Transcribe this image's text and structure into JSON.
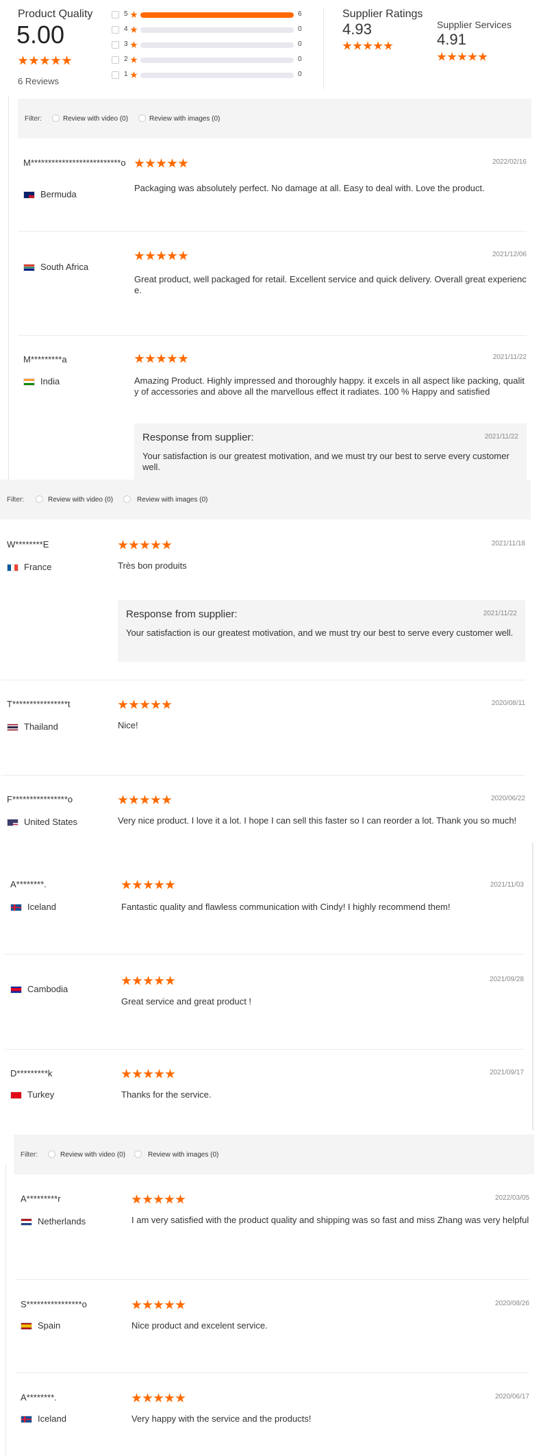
{
  "summary": {
    "product_quality_title": "Product Quality",
    "product_quality_score": "5.00",
    "reviews_count": "6 Reviews",
    "rating_rows": [
      {
        "num": "5",
        "count": "6",
        "fill": 1.0
      },
      {
        "num": "4",
        "count": "0",
        "fill": 0
      },
      {
        "num": "3",
        "count": "0",
        "fill": 0
      },
      {
        "num": "2",
        "count": "0",
        "fill": 0
      },
      {
        "num": "1",
        "count": "0",
        "fill": 0
      }
    ],
    "supplier_ratings_title": "Supplier Ratings",
    "supplier_ratings_score": "4.93",
    "supplier_services_title": "Supplier Services",
    "supplier_services_score": "4.91"
  },
  "filter": {
    "label": "Filter:",
    "video": "Review with video (0)",
    "images": "Review with images (0)"
  },
  "response_title": "Response from supplier:",
  "colors": {
    "accent": "#ff6a00",
    "panel": "#f4f4f4"
  },
  "reviews": [
    {
      "name": "M**************************o",
      "country": "Bermuda",
      "flag": "bermuda",
      "date": "2022/02/16",
      "text": "Packaging was absolutely perfect. No damage at all. Easy to deal with. Love the product."
    },
    {
      "name": "",
      "country": "South Africa",
      "flag": "south-africa",
      "date": "2021/12/06",
      "text": "Great product, well packaged for retail. Excellent service and quick delivery. Overall great experience."
    },
    {
      "name": "M*********a",
      "country": "India",
      "flag": "india",
      "date": "2021/11/22",
      "text": "Amazing Product. Highly impressed and thoroughly happy. it excels in all aspect like packing, quality of accessories and above all the marvellous effect it radiates. 100 % Happy and satisfied",
      "response": {
        "date": "2021/11/22",
        "text": "Your satisfaction is our greatest motivation, and we must try our best to serve every customer well."
      }
    },
    {
      "name": "W********E",
      "country": "France",
      "flag": "france",
      "date": "2021/11/18",
      "text": "Très bon produits",
      "response": {
        "date": "2021/11/22",
        "text": "Your satisfaction is our greatest motivation, and we must try our best to serve every customer well."
      }
    },
    {
      "name": "T****************t",
      "country": "Thailand",
      "flag": "thailand",
      "date": "2020/08/11",
      "text": "Nice!"
    },
    {
      "name": "F****************o",
      "country": "United States",
      "flag": "usa",
      "date": "2020/06/22",
      "text": "Very nice product. I love it a lot. I hope I can sell this faster so I can reorder a lot. Thank you so much!"
    },
    {
      "name": "A********.",
      "country": "Iceland",
      "flag": "iceland",
      "date": "2021/11/03",
      "text": "Fantastic quality and flawless communication with Cindy! I highly recommend them!"
    },
    {
      "name": "",
      "country": "Cambodia",
      "flag": "cambodia",
      "date": "2021/09/28",
      "text": "Great service and great product !"
    },
    {
      "name": "D*********k",
      "country": "Turkey",
      "flag": "turkey",
      "date": "2021/09/17",
      "text": "Thanks for the service."
    },
    {
      "name": "A*********r",
      "country": "Netherlands",
      "flag": "netherlands",
      "date": "2022/03/05",
      "text": "I am very satisfied with the product quality and shipping was so fast and miss Zhang was very helpful"
    },
    {
      "name": "S****************o",
      "country": "Spain",
      "flag": "spain",
      "date": "2020/08/26",
      "text": "Nice product and excelent service."
    },
    {
      "name": "A********.",
      "country": "Iceland",
      "flag": "iceland",
      "date": "2020/06/17",
      "text": "Very happy with the service and the products!"
    }
  ]
}
